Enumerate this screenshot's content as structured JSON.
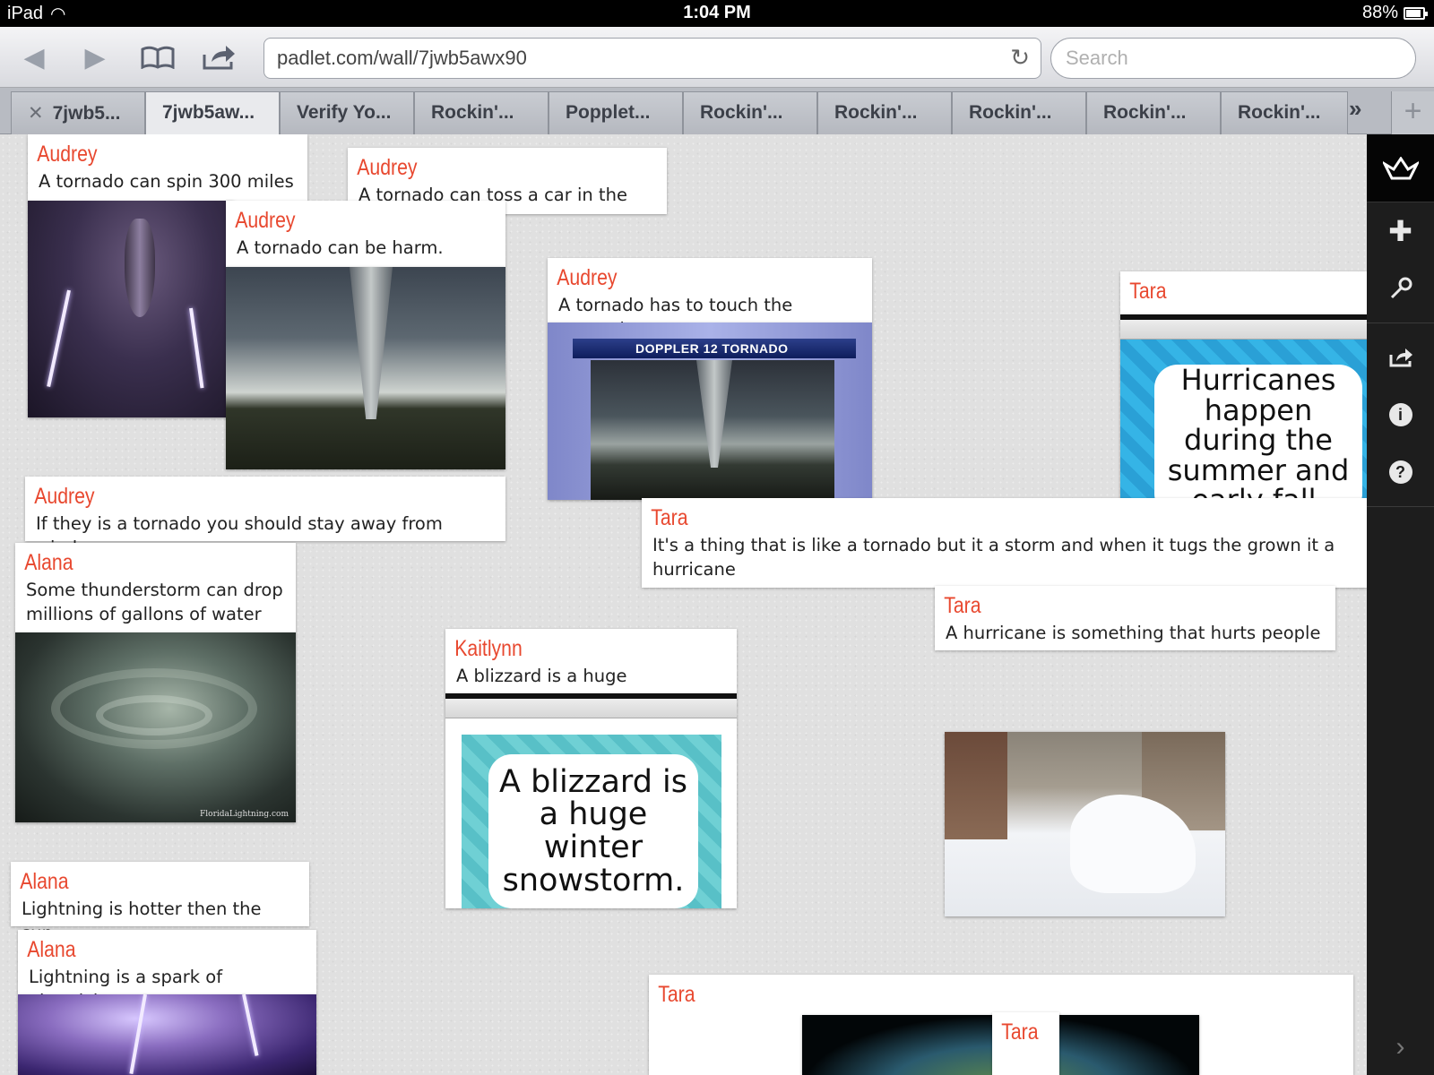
{
  "status_bar": {
    "device": "iPad",
    "time": "1:04 PM",
    "battery": "88%",
    "battery_level": 0.88
  },
  "browser": {
    "url": "padlet.com/wall/7jwb5awx90",
    "search_placeholder": "Search",
    "tabs": [
      {
        "label": "7jwb5..."
      },
      {
        "label": "7jwb5aw..."
      },
      {
        "label": "Verify Yo..."
      },
      {
        "label": "Rockin'..."
      },
      {
        "label": "Popplet..."
      },
      {
        "label": "Rockin'..."
      },
      {
        "label": "Rockin'..."
      },
      {
        "label": "Rockin'..."
      },
      {
        "label": "Rockin'..."
      },
      {
        "label": "Rockin'..."
      }
    ],
    "tab_overflow": "»",
    "tab_add": "+"
  },
  "posts": {
    "p1": {
      "author": "Audrey",
      "text": "A tornado can spin 300 miles"
    },
    "p2": {
      "author": "Audrey",
      "text": "A tornado can toss a car in the air."
    },
    "p3": {
      "author": "Audrey",
      "text": "A tornado can be harm."
    },
    "p4": {
      "author": "Audrey",
      "text": "A tornado has to touch the gounnd"
    },
    "p5": {
      "author": "Tara",
      "text": ""
    },
    "p6": {
      "author": "Audrey",
      "text": "If they is a tornado you should stay away from windos"
    },
    "p7": {
      "author": "Tara",
      "text": "It's a thing that is like a tornado but it a storm and when it tugs the grown it a hurricane"
    },
    "p8": {
      "author": "Alana",
      "text": "Some thunderstorm can drop millions of gallons of  water"
    },
    "p9": {
      "author": "Tara",
      "text": "A  hurricane is something that  hurts people"
    },
    "p10": {
      "author": "Kaitlynn",
      "text": "A blizzard is a huge snowstorm."
    },
    "p11": {
      "author": "Alana",
      "text": "Lightning is  hotter then the sun."
    },
    "p12": {
      "author": "Alana",
      "text": "Lightning is a spark of electricity"
    },
    "p13": {
      "author": "Tara",
      "text": ""
    },
    "p14": {
      "author": "Tara",
      "text": ""
    }
  },
  "images": {
    "doppler": {
      "caption": "DOPPLER 12  TORNADO"
    },
    "hurricane_sign": {
      "text": "Hurricanes happen during the summer and early fall."
    },
    "blizzard_sign": {
      "text": "A blizzard is a huge winter snowstorm."
    },
    "supercell_credit": {
      "text": "FloridaLightning.com"
    }
  },
  "colors": {
    "author": "#e8482f",
    "sidebar": "#1d1d1d"
  }
}
